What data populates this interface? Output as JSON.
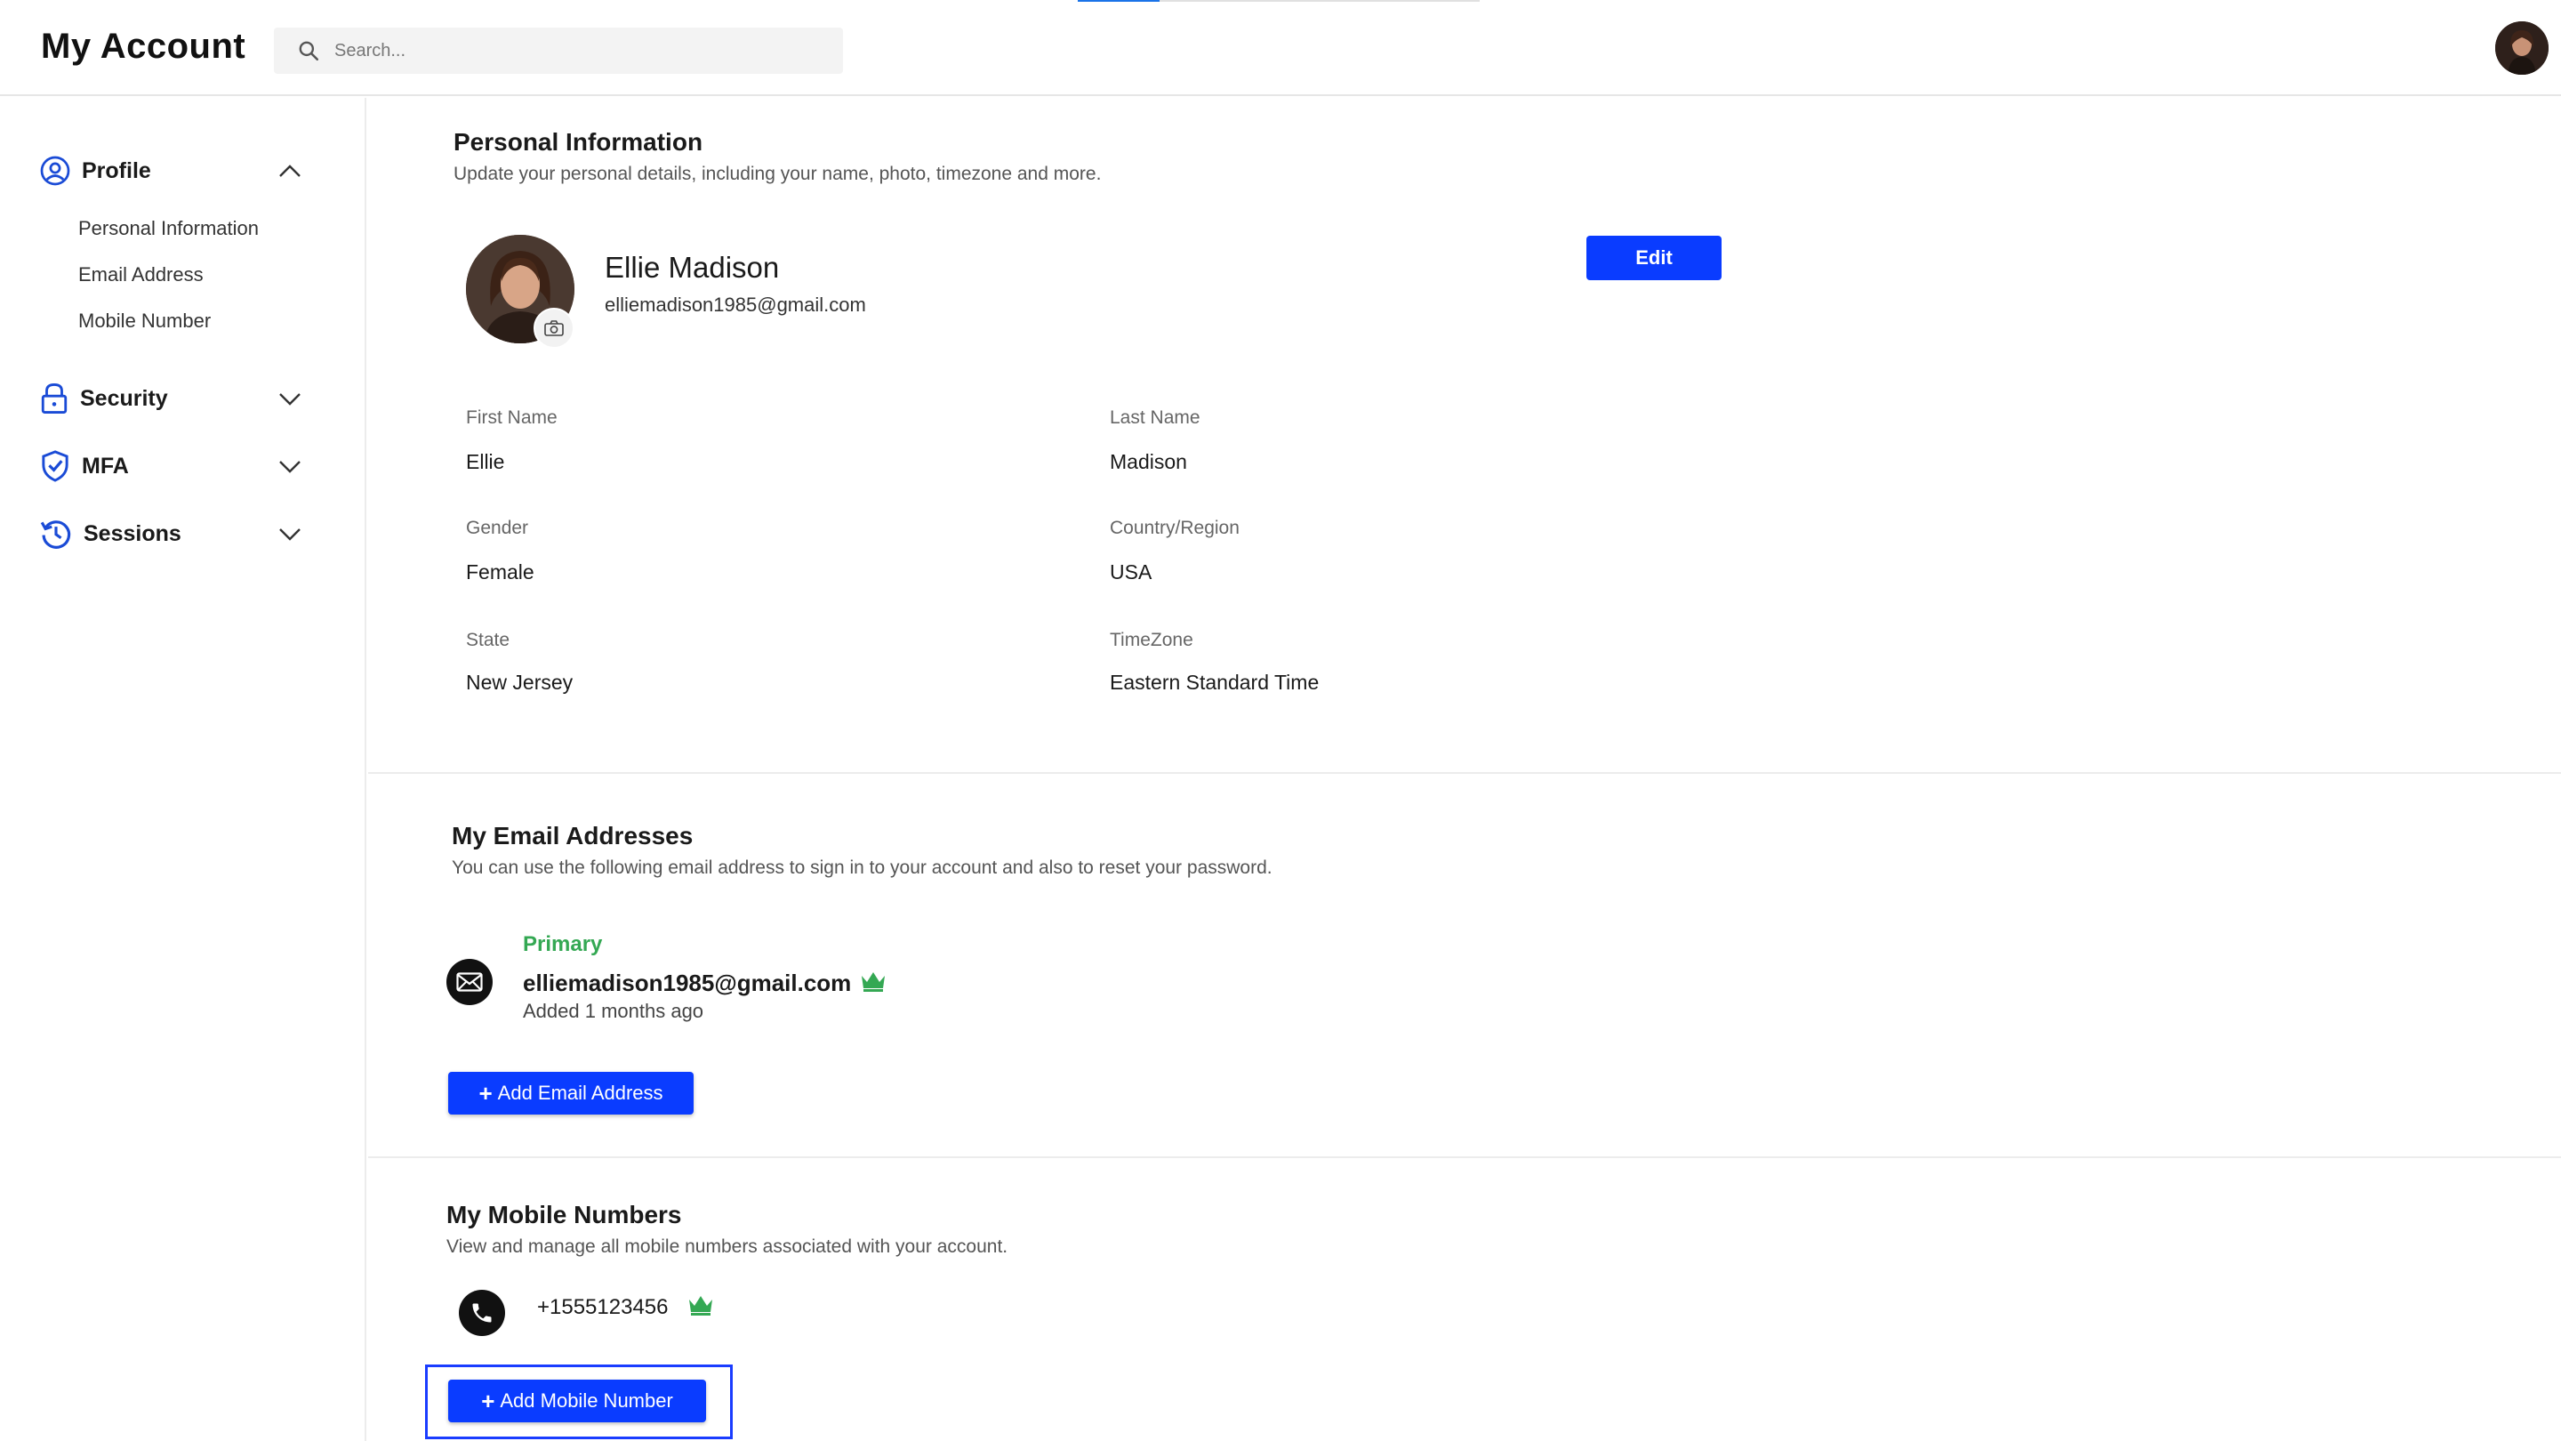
{
  "header": {
    "title": "My Account",
    "search_placeholder": "Search..."
  },
  "sidebar": {
    "groups": [
      {
        "label": "Profile",
        "icon": "user-circle-icon",
        "expanded": true,
        "items": [
          "Personal Information",
          "Email Address",
          "Mobile Number"
        ]
      },
      {
        "label": "Security",
        "icon": "lock-icon",
        "expanded": false
      },
      {
        "label": "MFA",
        "icon": "shield-check-icon",
        "expanded": false
      },
      {
        "label": "Sessions",
        "icon": "history-icon",
        "expanded": false
      }
    ]
  },
  "personal_info": {
    "title": "Personal Information",
    "description": "Update your personal details, including your name, photo, timezone and more.",
    "full_name": "Ellie Madison",
    "email": "elliemadison1985@gmail.com",
    "edit_label": "Edit",
    "fields": {
      "first_name": {
        "label": "First Name",
        "value": "Ellie"
      },
      "last_name": {
        "label": "Last Name",
        "value": "Madison"
      },
      "gender": {
        "label": "Gender",
        "value": "Female"
      },
      "country": {
        "label": "Country/Region",
        "value": "USA"
      },
      "state": {
        "label": "State",
        "value": "New Jersey"
      },
      "timezone": {
        "label": "TimeZone",
        "value": "Eastern Standard Time"
      }
    }
  },
  "emails": {
    "title": "My Email Addresses",
    "description": "You can use the following email address to sign in to your account and also to reset your password.",
    "primary_label": "Primary",
    "address": "elliemadison1985@gmail.com",
    "added": "Added 1 months ago",
    "add_label": "Add Email Address"
  },
  "mobiles": {
    "title": "My Mobile Numbers",
    "description": "View and manage all mobile numbers associated with your account.",
    "number": "+1555123456",
    "add_label": "Add Mobile Number"
  },
  "colors": {
    "accent": "#0a3cff",
    "primary_green": "#34a853",
    "nav_icon": "#1a4bd6"
  }
}
